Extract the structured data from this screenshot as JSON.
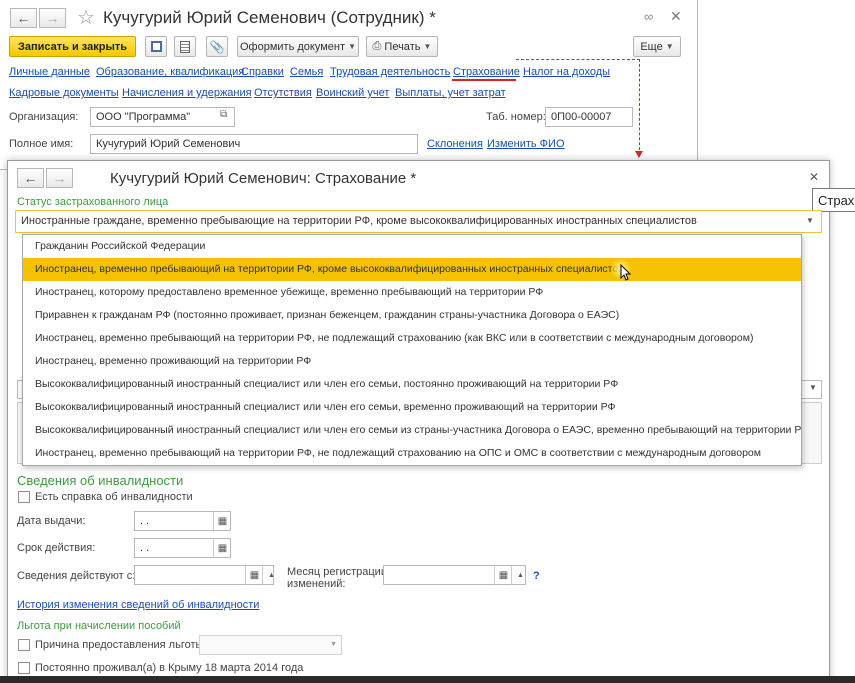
{
  "window_main": {
    "title": "Кучугурий Юрий Семенович (Сотрудник) *",
    "buttons": {
      "save_close": "Записать и закрыть",
      "oformit": "Оформить документ",
      "print": "Печать",
      "more": "Еще"
    },
    "tabs_row1": [
      "Личные данные",
      "Образование, квалификация",
      "Справки",
      "Семья",
      "Трудовая деятельность",
      "Страхование",
      "Налог на доходы"
    ],
    "tabs_row2": [
      "Кадровые документы",
      "Начисления и удержания",
      "Отсутствия",
      "Воинский учет",
      "Выплаты, учет затрат"
    ],
    "org_label": "Организация:",
    "org_value": "ООО \"Программа\"",
    "tab_label": "Таб. номер:",
    "tab_value": "0П00-00007",
    "fullname_label": "Полное имя:",
    "fullname_value": "Кучугурий Юрий Семенович",
    "link_declension": "Склонения",
    "link_change_name": "Изменить ФИО"
  },
  "window_insurance": {
    "title": "Кучугурий Юрий Семенович: Страхование *",
    "tooltip": "Страх",
    "status_label": "Статус застрахованного лица",
    "status_value": "Иностранные граждане, временно пребывающие на территории РФ, кроме высококвалифицированных иностранных специалистов",
    "options": [
      "Гражданин Российской Федерации",
      "Иностранец, временно пребывающий на территории РФ, кроме высококвалифицированных иностранных специалистов",
      "Иностранец, которому предоставлено временное убежище, временно пребывающий на территории РФ",
      "Приравнен к гражданам РФ (постоянно проживает, признан беженцем, гражданин страны-участника Договора о ЕАЭС)",
      "Иностранец, временно пребывающий на территории РФ, не подлежащий страхованию (как ВКС или в соответствии с международным договором)",
      "Иностранец, временно проживающий на территории РФ",
      "Высококвалифицированный иностранный специалист или член его семьи, постоянно проживающий на территории РФ",
      "Высококвалифицированный иностранный специалист или член его семьи, временно проживающий на территории РФ",
      "Высококвалифицированный иностранный специалист или член его семьи из страны-участника Договора о ЕАЭС, временно пребывающий на территории РФ",
      "Иностранец, временно пребывающий на территории РФ, не подлежащий страхованию на ОПС и ОМС в соответствии с международным договором"
    ],
    "selected_index": 1,
    "disability_heading": "Сведения об инвалидности",
    "has_certificate": "Есть справка об инвалидности",
    "issue_date_label": "Дата выдачи:",
    "validity_label": "Срок действия:",
    "date_placeholder": " .  .",
    "effective_label": "Сведения действуют с:",
    "month_reg_label1": "Месяц регистрации",
    "month_reg_label2": "изменений:",
    "help": "?",
    "history_link": "История изменения сведений об инвалидности",
    "benefit_heading": "Льгота при начислении пособий",
    "benefit_reason": "Причина предоставления льготы",
    "crimea": "Постоянно проживал(а) в Крыму 18 марта 2014 года"
  }
}
